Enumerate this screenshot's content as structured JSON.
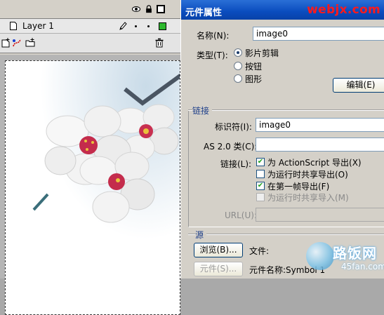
{
  "timeline": {
    "layer_name": "Layer 1"
  },
  "dialog": {
    "title": "元件属性",
    "watermark": "webjx.com",
    "name_label": "名称(N):",
    "name_value": "image0",
    "type_label": "类型(T):",
    "type_options": [
      "影片剪辑",
      "按钮",
      "图形"
    ],
    "type_selected": "影片剪辑",
    "edit_button": "编辑(E)",
    "linkage_section": "链接",
    "identifier_label": "标识符(I):",
    "identifier_value": "image0",
    "as2_label": "AS 2.0 类(C):",
    "as2_value": "",
    "linkage_label": "链接(L):",
    "linkage_options": [
      {
        "label": "为 ActionScript 导出(X)",
        "checked": true,
        "enabled": true
      },
      {
        "label": "为运行时共享导出(O)",
        "checked": false,
        "enabled": true
      },
      {
        "label": "在第一帧导出(F)",
        "checked": true,
        "enabled": true
      },
      {
        "label": "为运行时共享导入(M)",
        "checked": false,
        "enabled": false
      }
    ],
    "url_label": "URL(U):",
    "url_value": "",
    "source_section": "源",
    "browse_button": "浏览(B)...",
    "file_label": "文件:",
    "symbol_button": "元件(S)...",
    "symbol_name_label": "元件名称:Symbol 1"
  },
  "logo": {
    "text": "路饭网",
    "sub": "45fan.com"
  },
  "colors": {
    "titlebar": "#0a4cbe",
    "watermark": "#ff1a1a",
    "check": "#21a121",
    "layer_color": "#2db82d"
  }
}
